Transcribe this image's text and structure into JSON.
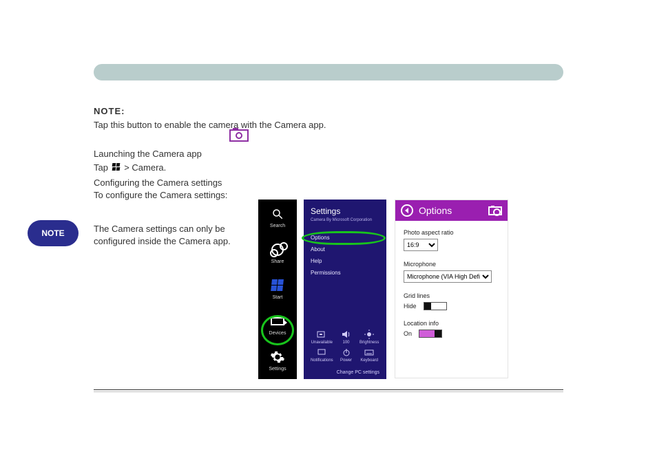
{
  "section": {
    "label": "NOTE:",
    "desc": "Tap this button to enable the camera with the Camera app."
  },
  "para1": "Launching the Camera app",
  "para2_parts": {
    "a": "Tap ",
    "b": " > Camera."
  },
  "list3": "Configuring the Camera settings",
  "list4": "To configure the Camera settings:",
  "note_pill": "NOTE",
  "note_text": "The Camera settings can only be configured inside the Camera app.",
  "charms": {
    "search": "Search",
    "share": "Share",
    "start": "Start",
    "devices": "Devices",
    "settings": "Settings"
  },
  "settings_panel": {
    "title": "Settings",
    "subtitle": "Camera\nBy Microsoft Corporation",
    "items": [
      "Options",
      "About",
      "Help",
      "Permissions"
    ],
    "tiles": [
      "Unavailable",
      "100",
      "Brightness",
      "Notifications",
      "Power",
      "Keyboard"
    ],
    "change": "Change PC settings"
  },
  "options": {
    "title": "Options",
    "aspect_label": "Photo aspect ratio",
    "aspect_value": "16:9",
    "mic_label": "Microphone",
    "mic_value": "Microphone (VIA High Definit",
    "grid_label": "Grid lines",
    "grid_state": "Hide",
    "loc_label": "Location info",
    "loc_state": "On"
  }
}
